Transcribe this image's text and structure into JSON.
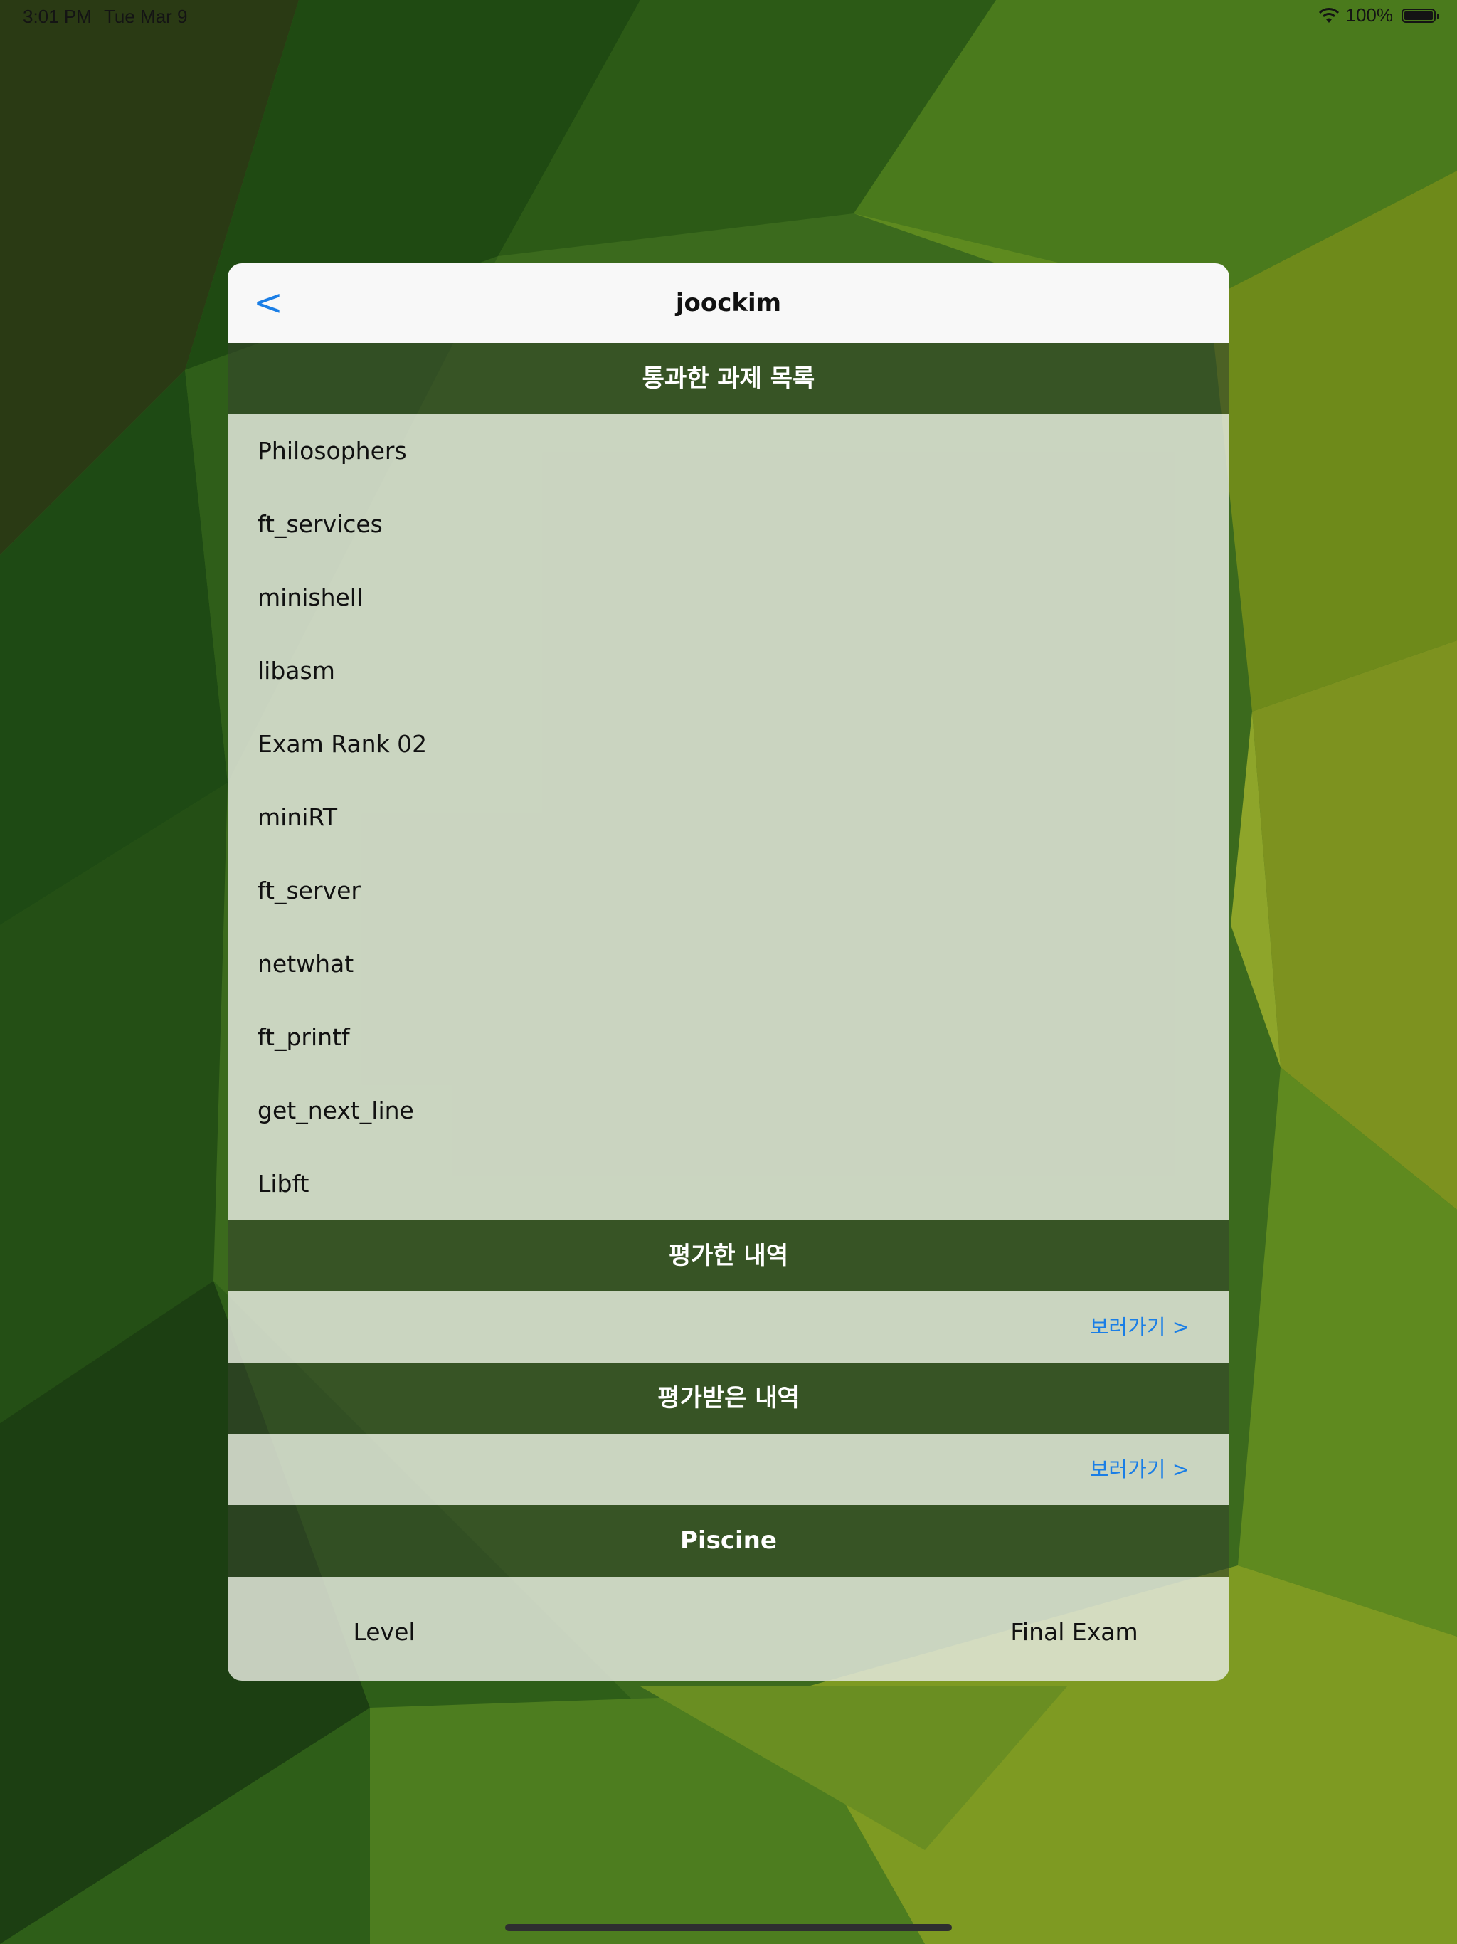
{
  "status_bar": {
    "time": "3:01 PM",
    "date": "Tue Mar 9",
    "battery": "100%"
  },
  "nav": {
    "back_label": "<",
    "title": "joockim"
  },
  "passed_projects": {
    "header": "통과한 과제 목록",
    "items": [
      "Philosophers",
      "ft_services",
      "minishell",
      "libasm",
      "Exam Rank 02",
      "miniRT",
      "ft_server",
      "netwhat",
      "ft_printf",
      "get_next_line",
      "Libft"
    ]
  },
  "evaluations_given": {
    "header": "평가한 내역",
    "link": "보러가기 >"
  },
  "evaluations_received": {
    "header": "평가받은 내역",
    "link": "보러가기 >"
  },
  "piscine": {
    "header": "Piscine",
    "level_label": "Level",
    "final_exam_label": "Final Exam"
  },
  "colors": {
    "accent": "#1a7ee6",
    "header_overlay": "#36462c"
  }
}
